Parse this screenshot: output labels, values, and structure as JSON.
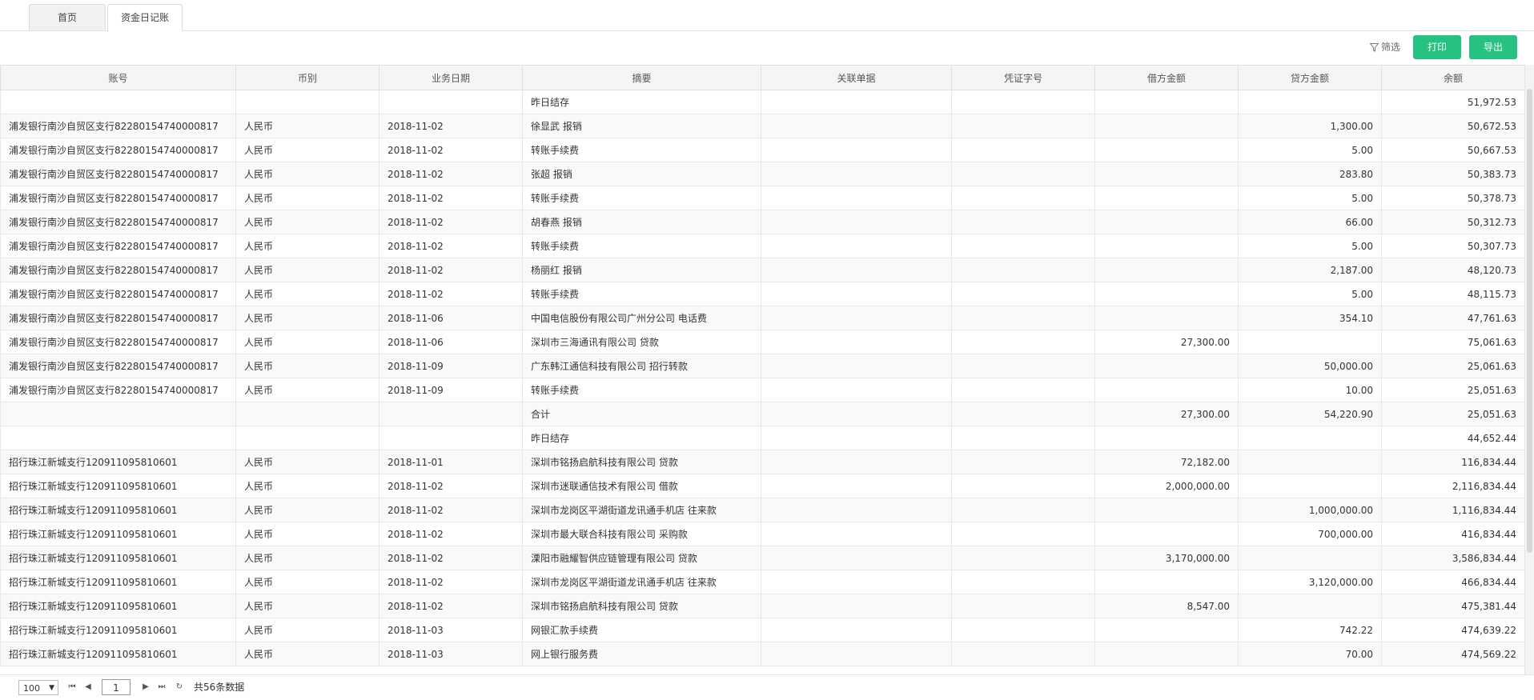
{
  "tabs": [
    {
      "label": "首页"
    },
    {
      "label": "资金日记账"
    }
  ],
  "toolbar": {
    "filter_label": "筛选",
    "print_label": "打印",
    "export_label": "导出"
  },
  "table": {
    "columns": [
      "账号",
      "币别",
      "业务日期",
      "摘要",
      "关联单据",
      "凭证字号",
      "借方金额",
      "贷方金额",
      "余额"
    ],
    "rows": [
      [
        "",
        "",
        "",
        "昨日结存",
        "",
        "",
        "",
        "",
        "51,972.53"
      ],
      [
        "浦发银行南沙自贸区支行82280154740000817",
        "人民币",
        "2018-11-02",
        "徐显武 报销",
        "",
        "",
        "",
        "1,300.00",
        "50,672.53"
      ],
      [
        "浦发银行南沙自贸区支行82280154740000817",
        "人民币",
        "2018-11-02",
        "转账手续费",
        "",
        "",
        "",
        "5.00",
        "50,667.53"
      ],
      [
        "浦发银行南沙自贸区支行82280154740000817",
        "人民币",
        "2018-11-02",
        "张超 报销",
        "",
        "",
        "",
        "283.80",
        "50,383.73"
      ],
      [
        "浦发银行南沙自贸区支行82280154740000817",
        "人民币",
        "2018-11-02",
        "转账手续费",
        "",
        "",
        "",
        "5.00",
        "50,378.73"
      ],
      [
        "浦发银行南沙自贸区支行82280154740000817",
        "人民币",
        "2018-11-02",
        "胡春燕 报销",
        "",
        "",
        "",
        "66.00",
        "50,312.73"
      ],
      [
        "浦发银行南沙自贸区支行82280154740000817",
        "人民币",
        "2018-11-02",
        "转账手续费",
        "",
        "",
        "",
        "5.00",
        "50,307.73"
      ],
      [
        "浦发银行南沙自贸区支行82280154740000817",
        "人民币",
        "2018-11-02",
        "杨丽红 报销",
        "",
        "",
        "",
        "2,187.00",
        "48,120.73"
      ],
      [
        "浦发银行南沙自贸区支行82280154740000817",
        "人民币",
        "2018-11-02",
        "转账手续费",
        "",
        "",
        "",
        "5.00",
        "48,115.73"
      ],
      [
        "浦发银行南沙自贸区支行82280154740000817",
        "人民币",
        "2018-11-06",
        "中国电信股份有限公司广州分公司 电话费",
        "",
        "",
        "",
        "354.10",
        "47,761.63"
      ],
      [
        "浦发银行南沙自贸区支行82280154740000817",
        "人民币",
        "2018-11-06",
        "深圳市三海通讯有限公司 贷款",
        "",
        "",
        "27,300.00",
        "",
        "75,061.63"
      ],
      [
        "浦发银行南沙自贸区支行82280154740000817",
        "人民币",
        "2018-11-09",
        "广东韩江通信科技有限公司 招行转款",
        "",
        "",
        "",
        "50,000.00",
        "25,061.63"
      ],
      [
        "浦发银行南沙自贸区支行82280154740000817",
        "人民币",
        "2018-11-09",
        "转账手续费",
        "",
        "",
        "",
        "10.00",
        "25,051.63"
      ],
      [
        "",
        "",
        "",
        "合计",
        "",
        "",
        "27,300.00",
        "54,220.90",
        "25,051.63"
      ],
      [
        "",
        "",
        "",
        "昨日结存",
        "",
        "",
        "",
        "",
        "44,652.44"
      ],
      [
        "招行珠江新城支行120911095810601",
        "人民币",
        "2018-11-01",
        "深圳市铭扬启航科技有限公司 贷款",
        "",
        "",
        "72,182.00",
        "",
        "116,834.44"
      ],
      [
        "招行珠江新城支行120911095810601",
        "人民币",
        "2018-11-02",
        "深圳市迷联通信技术有限公司 借款",
        "",
        "",
        "2,000,000.00",
        "",
        "2,116,834.44"
      ],
      [
        "招行珠江新城支行120911095810601",
        "人民币",
        "2018-11-02",
        "深圳市龙岗区平湖街道龙讯通手机店 往来款",
        "",
        "",
        "",
        "1,000,000.00",
        "1,116,834.44"
      ],
      [
        "招行珠江新城支行120911095810601",
        "人民币",
        "2018-11-02",
        "深圳市最大联合科技有限公司 采购款",
        "",
        "",
        "",
        "700,000.00",
        "416,834.44"
      ],
      [
        "招行珠江新城支行120911095810601",
        "人民币",
        "2018-11-02",
        "溧阳市融耀智供应链管理有限公司 贷款",
        "",
        "",
        "3,170,000.00",
        "",
        "3,586,834.44"
      ],
      [
        "招行珠江新城支行120911095810601",
        "人民币",
        "2018-11-02",
        "深圳市龙岗区平湖街道龙讯通手机店 往来款",
        "",
        "",
        "",
        "3,120,000.00",
        "466,834.44"
      ],
      [
        "招行珠江新城支行120911095810601",
        "人民币",
        "2018-11-02",
        "深圳市铭扬启航科技有限公司 贷款",
        "",
        "",
        "8,547.00",
        "",
        "475,381.44"
      ],
      [
        "招行珠江新城支行120911095810601",
        "人民币",
        "2018-11-03",
        "网银汇款手续费",
        "",
        "",
        "",
        "742.22",
        "474,639.22"
      ],
      [
        "招行珠江新城支行120911095810601",
        "人民币",
        "2018-11-03",
        "网上银行服务费",
        "",
        "",
        "",
        "70.00",
        "474,569.22"
      ]
    ]
  },
  "pager": {
    "page_size": "100",
    "page": "1",
    "total": "共56条数据"
  }
}
